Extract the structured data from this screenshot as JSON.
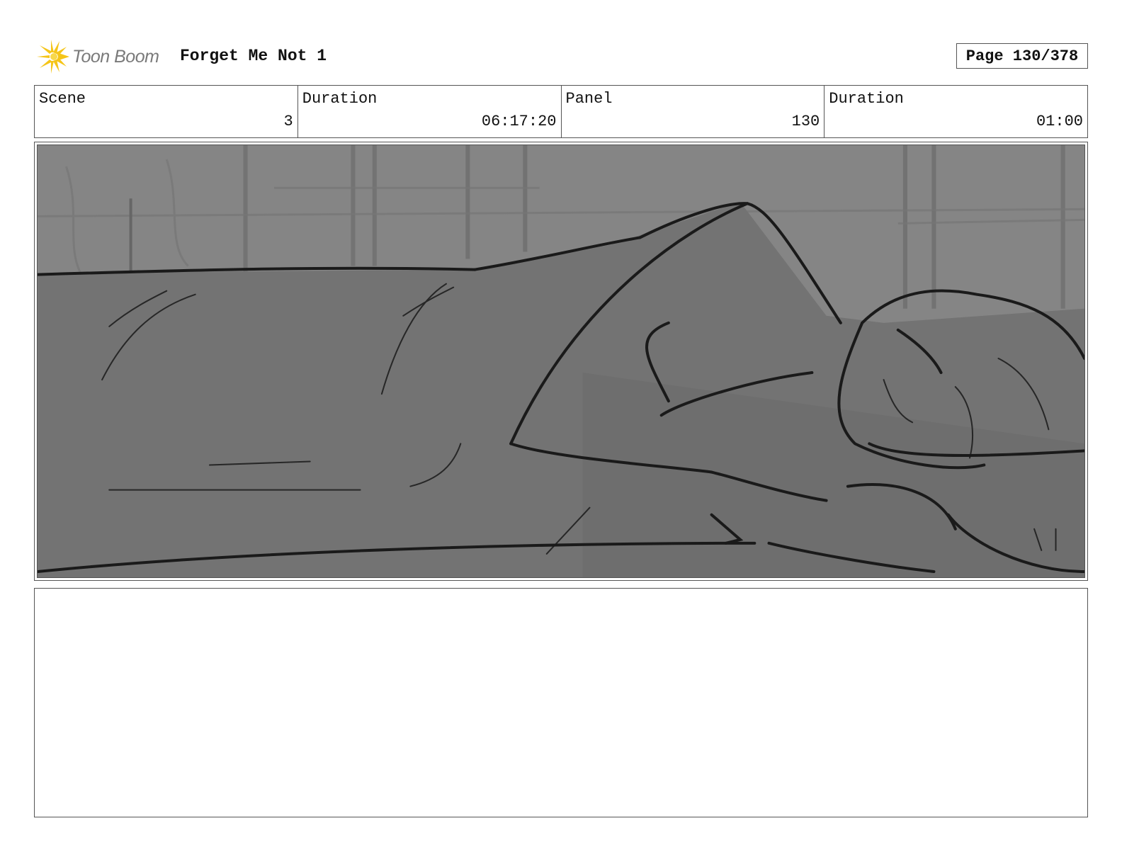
{
  "header": {
    "logo_text": "Toon Boom",
    "project_title": "Forget Me Not 1",
    "page_label": "Page 130/378"
  },
  "info": [
    {
      "label": "Scene",
      "value": "3"
    },
    {
      "label": "Duration",
      "value": "06:17:20"
    },
    {
      "label": "Panel",
      "value": "130"
    },
    {
      "label": "Duration",
      "value": "01:00"
    }
  ],
  "panel": {
    "image_icon": "storyboard-sketch-sleeping-figure",
    "background_color": "#7d7d7d"
  },
  "notes": {
    "text": ""
  },
  "colors": {
    "logo_accent": "#f5c518",
    "logo_text": "#7a7a7a",
    "border": "#555555"
  }
}
